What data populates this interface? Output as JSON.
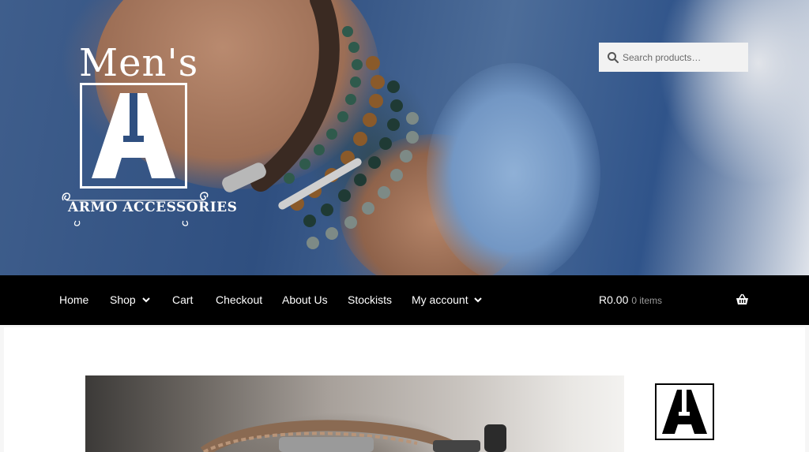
{
  "header": {
    "logo": {
      "line1": "Men's",
      "brand": "ARMO ACCESSORIES"
    },
    "search": {
      "placeholder": "Search products…",
      "icon": "search-icon"
    }
  },
  "nav": {
    "items": [
      {
        "label": "Home",
        "active": true,
        "dropdown": false
      },
      {
        "label": "Shop",
        "active": false,
        "dropdown": true
      },
      {
        "label": "Cart",
        "active": false,
        "dropdown": false
      },
      {
        "label": "Checkout",
        "active": false,
        "dropdown": false
      },
      {
        "label": "About Us",
        "active": false,
        "dropdown": false
      },
      {
        "label": "Stockists",
        "active": false,
        "dropdown": false
      },
      {
        "label": "My account",
        "active": false,
        "dropdown": true
      }
    ],
    "cart": {
      "total": "R0.00",
      "items": "0 items",
      "icon": "basket-icon"
    }
  },
  "colors": {
    "nav_background": "#000000",
    "nav_text": "#ffffff",
    "cart_count_text": "#9b9b9b",
    "search_background": "#f2f2f2"
  }
}
